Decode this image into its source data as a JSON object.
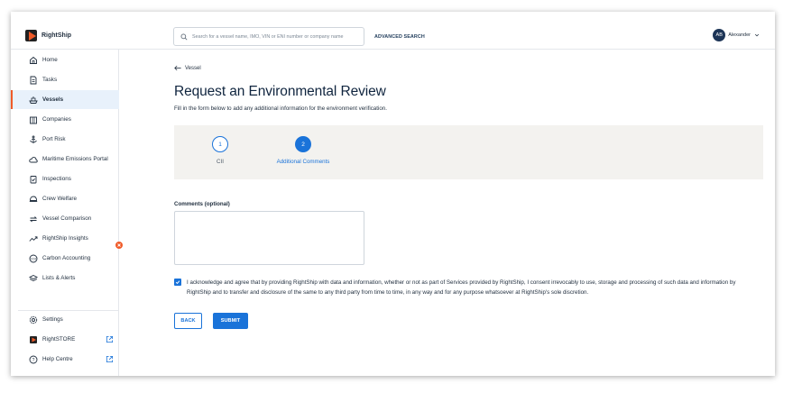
{
  "brand": {
    "name": "RightShip"
  },
  "header": {
    "search_placeholder": "Search for a vessel name, IMO, VIN or ENI number or company name",
    "advanced_search": "ADVANCED SEARCH",
    "user_initials": "AB",
    "user_name": "Alexander"
  },
  "sidebar": {
    "items": [
      {
        "label": "Home",
        "icon": "home-icon"
      },
      {
        "label": "Tasks",
        "icon": "document-icon"
      },
      {
        "label": "Vessels",
        "icon": "ship-icon",
        "active": true
      },
      {
        "label": "Companies",
        "icon": "building-icon"
      },
      {
        "label": "Port Risk",
        "icon": "anchor-icon"
      },
      {
        "label": "Maritime Emissions Portal",
        "icon": "cloud-icon"
      },
      {
        "label": "Inspections",
        "icon": "clipboard-check-icon"
      },
      {
        "label": "Crew Welfare",
        "icon": "helmet-icon"
      },
      {
        "label": "Vessel Comparison",
        "icon": "arrows-exchange-icon"
      },
      {
        "label": "RightShip Insights",
        "icon": "trending-up-icon"
      },
      {
        "label": "Carbon Accounting",
        "icon": "co2-icon"
      },
      {
        "label": "Lists & Alerts",
        "icon": "layers-icon"
      }
    ],
    "bottom_items": [
      {
        "label": "Settings",
        "icon": "gear-icon"
      },
      {
        "label": "RightSTORE",
        "icon": "rightship-logo-icon",
        "external": true
      },
      {
        "label": "Help Centre",
        "icon": "help-circle-icon",
        "external": true
      }
    ]
  },
  "main": {
    "back_label": "Vessel",
    "title": "Request an Environmental Review",
    "subtitle": "Fill in the form below to add any additional information for the environment verification.",
    "steps": [
      {
        "number": "1",
        "label": "CII",
        "state": "done"
      },
      {
        "number": "2",
        "label": "Additional Comments",
        "state": "current"
      }
    ],
    "comments_label": "Comments (optional)",
    "comments_value": "",
    "consent_checked": true,
    "consent_text": "I acknowledge and agree that by providing RightShip with data and information, whether or not as part of Services provided by RightShip, I consent irrevocably to use, storage and processing of such data and information by RightShip and to transfer and disclosure of the same to any third party from time to time, in any way and for any purpose whatsoever at RightShip's sole discretion.",
    "back_button": "BACK",
    "submit_button": "SUBMIT"
  },
  "colors": {
    "accent": "#1a73d9",
    "brand_orange": "#f05a28",
    "active_bg": "#e8f1fb",
    "stepper_bg": "#f3f2ef"
  }
}
